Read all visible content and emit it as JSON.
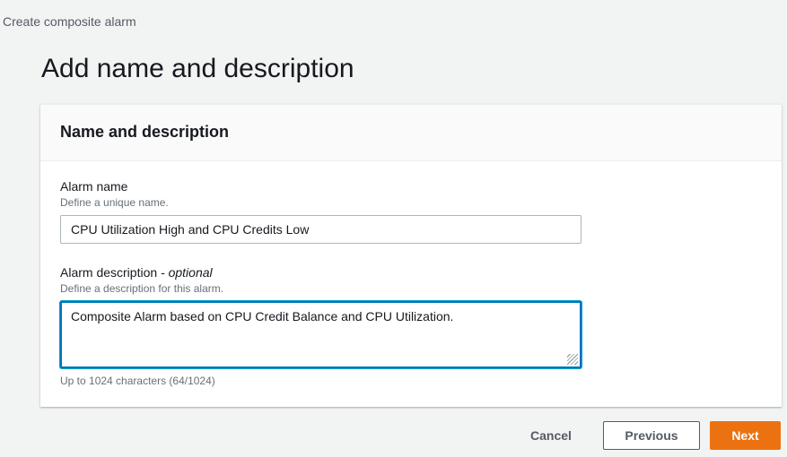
{
  "breadcrumb": "Create composite alarm",
  "page_title": "Add name and description",
  "panel": {
    "title": "Name and description",
    "alarm_name": {
      "label": "Alarm name",
      "hint": "Define a unique name.",
      "value": "CPU Utilization High and CPU Credits Low"
    },
    "alarm_description": {
      "label": "Alarm description",
      "optional": "- optional",
      "hint": "Define a description for this alarm.",
      "value": "Composite Alarm based on CPU Credit Balance and CPU Utilization.",
      "constraint": "Up to 1024 characters (64/1024)"
    }
  },
  "buttons": {
    "cancel": "Cancel",
    "previous": "Previous",
    "next": "Next"
  }
}
